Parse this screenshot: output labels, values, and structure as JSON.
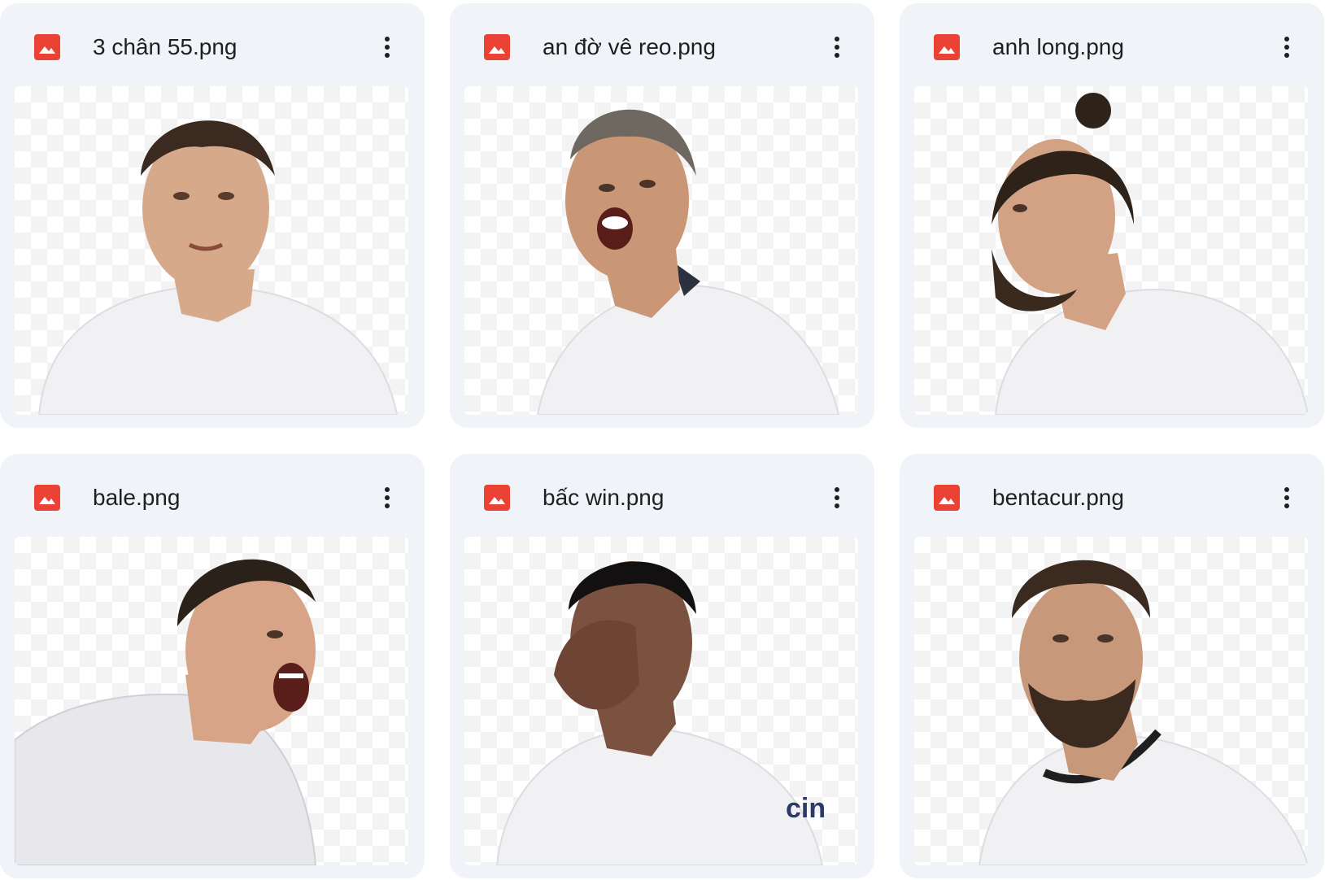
{
  "files": [
    {
      "name": "3 chân 55.png",
      "icon": "image-file-icon",
      "hair": "#3a2a20",
      "skin": "#d7a98b"
    },
    {
      "name": "an đờ vê reo.png",
      "icon": "image-file-icon",
      "hair": "#6f6861",
      "skin": "#c99676"
    },
    {
      "name": "anh long.png",
      "icon": "image-file-icon",
      "hair": "#2e2219",
      "skin": "#d3a285"
    },
    {
      "name": "bale.png",
      "icon": "image-file-icon",
      "hair": "#2a2118",
      "skin": "#d8a487"
    },
    {
      "name": "bấc win.png",
      "icon": "image-file-icon",
      "hair": "#121010",
      "skin": "#7b5140"
    },
    {
      "name": "bentacur.png",
      "icon": "image-file-icon",
      "hair": "#3b2a1f",
      "skin": "#c8987b"
    }
  ],
  "colors": {
    "card_bg": "#f0f4f9",
    "icon_red": "#ea4335",
    "text": "#1f1f1f",
    "shirt": "#f1f1f3"
  }
}
